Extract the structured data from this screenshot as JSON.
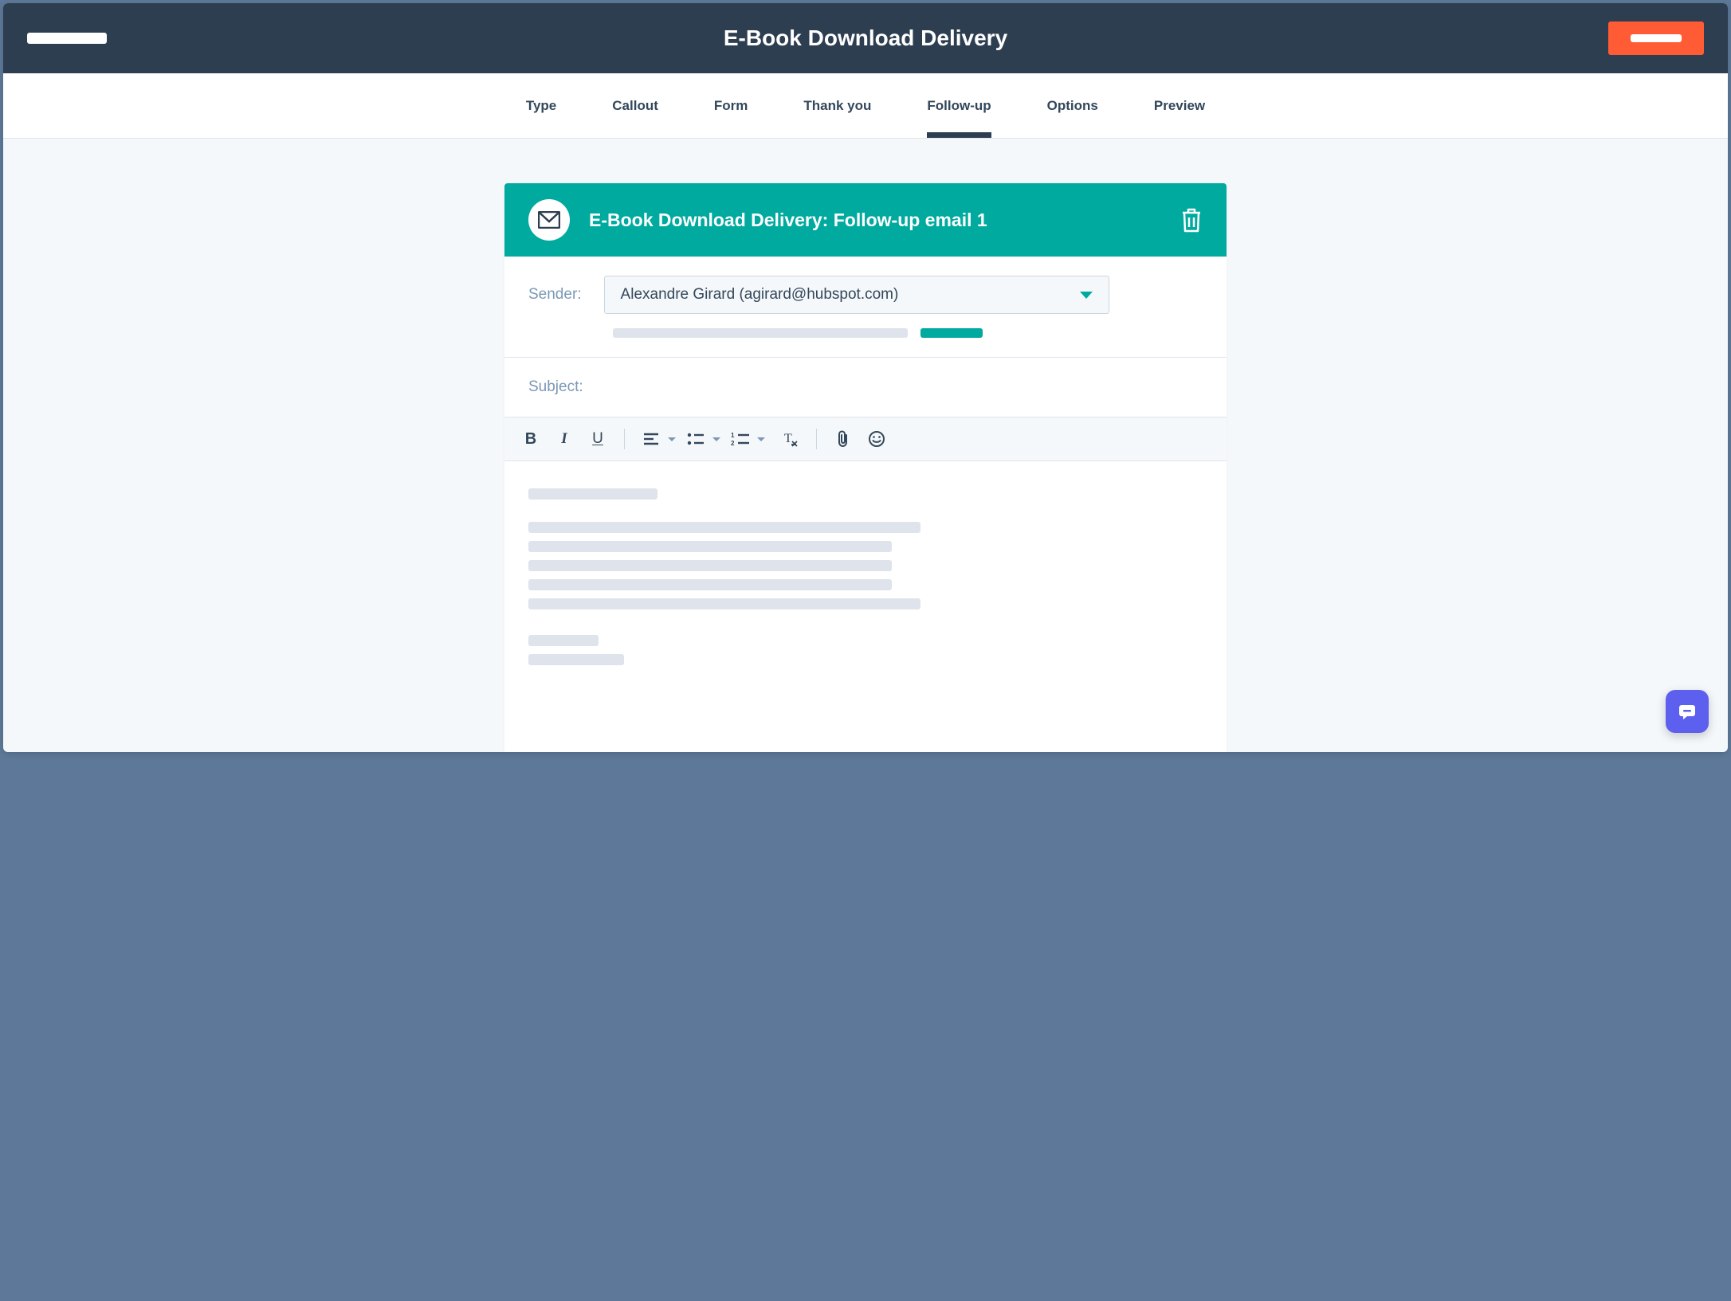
{
  "header": {
    "title": "E-Book Download Delivery"
  },
  "tabs": [
    {
      "label": "Type",
      "active": false
    },
    {
      "label": "Callout",
      "active": false
    },
    {
      "label": "Form",
      "active": false
    },
    {
      "label": "Thank you",
      "active": false
    },
    {
      "label": "Follow-up",
      "active": true
    },
    {
      "label": "Options",
      "active": false
    },
    {
      "label": "Preview",
      "active": false
    }
  ],
  "email": {
    "card_title": "E-Book Download Delivery: Follow-up email 1",
    "sender_label": "Sender:",
    "sender_value": "Alexandre Girard (agirard@hubspot.com)",
    "subject_label": "Subject:"
  },
  "toolbar": {
    "bold": "B",
    "italic": "I",
    "underline": "U"
  },
  "icons": {
    "mail": "mail-icon",
    "trash": "trash-icon",
    "align": "align-icon",
    "bullets": "bullets-icon",
    "numbered": "numbered-icon",
    "clear_format": "clear-format-icon",
    "attachment": "attachment-icon",
    "emoji": "emoji-icon",
    "chat": "chat-icon"
  },
  "colors": {
    "header_bg": "#2d3e50",
    "accent": "#00aa9e",
    "cta": "#ff5c35",
    "text": "#33475b",
    "muted": "#7c98b6",
    "chat": "#5d5fef"
  }
}
